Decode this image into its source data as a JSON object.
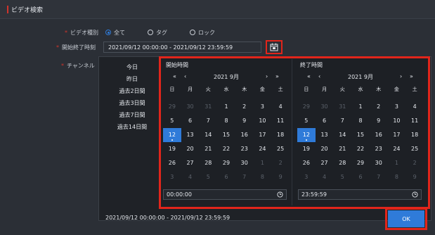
{
  "header": {
    "title": "ビデオ検索"
  },
  "form": {
    "video_type_label": "ビデオ種別",
    "video_type_options": [
      "全て",
      "タグ",
      "ロック"
    ],
    "start_end_label": "開始終了時刻",
    "time_range_value": "2021/09/12 00:00:00 - 2021/09/12 23:59:59",
    "channel_label": "チャンネル"
  },
  "quick_ranges": [
    "今日",
    "昨日",
    "過去2日間",
    "過去3日間",
    "過去7日間",
    "過去14日間"
  ],
  "start_calendar": {
    "caption": "開始時間",
    "nav_prev_year": "«",
    "nav_prev_month": "‹",
    "month_label": "2021 9月",
    "nav_next_month": "›",
    "nav_next_year": "»",
    "time": "00:00:00"
  },
  "end_calendar": {
    "caption": "終了時間",
    "nav_prev_year": "«",
    "nav_prev_month": "‹",
    "month_label": "2021 9月",
    "nav_next_month": "›",
    "nav_next_year": "»",
    "time": "23:59:59"
  },
  "weekdays": [
    "日",
    "月",
    "火",
    "水",
    "木",
    "金",
    "土"
  ],
  "days": [
    {
      "d": "29",
      "m": true
    },
    {
      "d": "30",
      "m": true
    },
    {
      "d": "31",
      "m": true
    },
    {
      "d": "1"
    },
    {
      "d": "2"
    },
    {
      "d": "3"
    },
    {
      "d": "4"
    },
    {
      "d": "5"
    },
    {
      "d": "6"
    },
    {
      "d": "7"
    },
    {
      "d": "8"
    },
    {
      "d": "9"
    },
    {
      "d": "10"
    },
    {
      "d": "11"
    },
    {
      "d": "12",
      "s": true
    },
    {
      "d": "13"
    },
    {
      "d": "14"
    },
    {
      "d": "15"
    },
    {
      "d": "16"
    },
    {
      "d": "17"
    },
    {
      "d": "18"
    },
    {
      "d": "19"
    },
    {
      "d": "20"
    },
    {
      "d": "21"
    },
    {
      "d": "22"
    },
    {
      "d": "23"
    },
    {
      "d": "24"
    },
    {
      "d": "25"
    },
    {
      "d": "26"
    },
    {
      "d": "27"
    },
    {
      "d": "28"
    },
    {
      "d": "29"
    },
    {
      "d": "30"
    },
    {
      "d": "1",
      "m": true
    },
    {
      "d": "2",
      "m": true
    },
    {
      "d": "3",
      "m": true
    },
    {
      "d": "4",
      "m": true
    },
    {
      "d": "5",
      "m": true
    },
    {
      "d": "6",
      "m": true
    },
    {
      "d": "7",
      "m": true
    },
    {
      "d": "8",
      "m": true
    },
    {
      "d": "9",
      "m": true
    }
  ],
  "footer": {
    "range_text": "2021/09/12 00:00:00 - 2021/09/12 23:59:59",
    "ok_label": "OK"
  },
  "colors": {
    "accent": "#2f7bd9",
    "highlight": "#e1251b"
  }
}
